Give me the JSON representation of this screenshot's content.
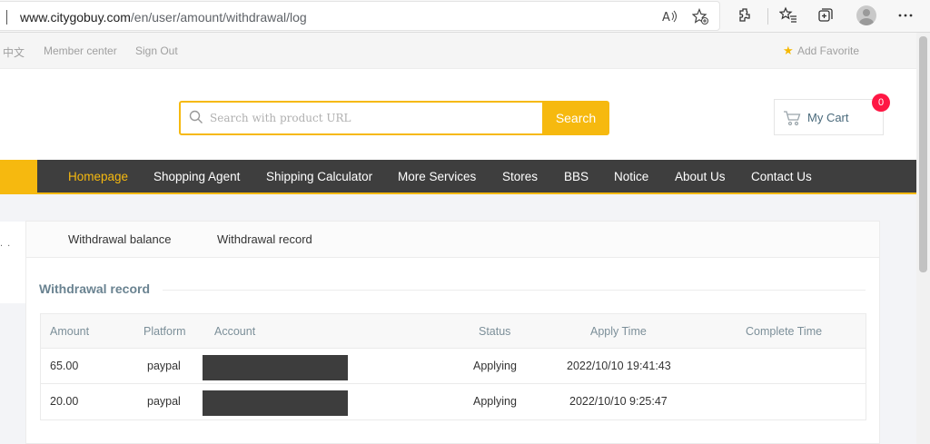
{
  "browser": {
    "url_host": "www.citygobuy.com",
    "url_path": "/en/user/amount/withdrawal/log",
    "icons": [
      "read-aloud-icon",
      "add-favorite-icon",
      "extensions-icon",
      "favorites-icon",
      "collections-icon",
      "profile-avatar",
      "more-menu-icon"
    ]
  },
  "topbar": {
    "language": "中文",
    "member_center": "Member center",
    "sign_out": "Sign Out",
    "add_favorite": "Add Favorite"
  },
  "header": {
    "search_placeholder": "Search with product URL",
    "search_button": "Search",
    "cart_label": "My Cart",
    "cart_count": "0"
  },
  "nav": {
    "items": [
      {
        "label": "Homepage",
        "active": true
      },
      {
        "label": "Shopping Agent",
        "active": false
      },
      {
        "label": "Shipping Calculator",
        "active": false
      },
      {
        "label": "More Services",
        "active": false
      },
      {
        "label": "Stores",
        "active": false
      },
      {
        "label": "BBS",
        "active": false
      },
      {
        "label": "Notice",
        "active": false
      },
      {
        "label": "About Us",
        "active": false
      },
      {
        "label": "Contact Us",
        "active": false
      }
    ]
  },
  "side": {
    "dots": ". ."
  },
  "tabs": [
    {
      "label": "Withdrawal balance"
    },
    {
      "label": "Withdrawal record"
    }
  ],
  "section_title": "Withdrawal record",
  "table": {
    "headers": [
      "Amount",
      "Platform",
      "Account",
      "Status",
      "Apply Time",
      "Complete Time"
    ],
    "rows": [
      {
        "amount": "65.00",
        "platform": "paypal",
        "account": "",
        "status": "Applying",
        "apply_time": "2022/10/10 19:41:43",
        "complete_time": ""
      },
      {
        "amount": "20.00",
        "platform": "paypal",
        "account": "",
        "status": "Applying",
        "apply_time": "2022/10/10 9:25:47",
        "complete_time": ""
      }
    ]
  },
  "colors": {
    "accent": "#f6b90f",
    "nav_bg": "#3e3e3e",
    "badge": "#ff1744",
    "title": "#6a8391"
  }
}
